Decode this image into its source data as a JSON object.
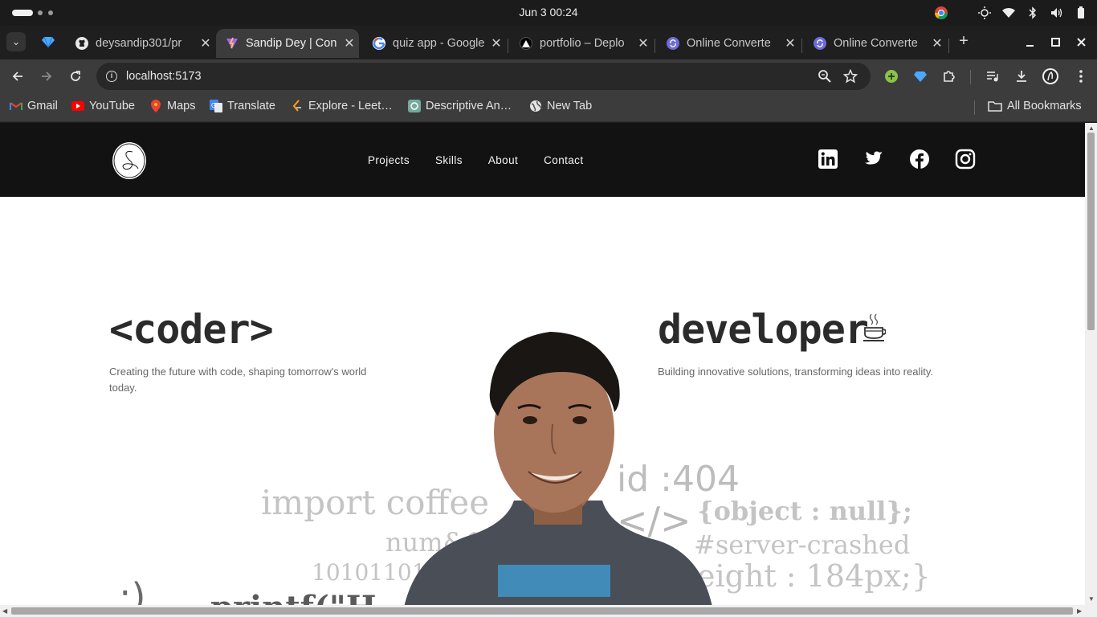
{
  "os": {
    "clock": "Jun 3  00:24"
  },
  "tabs": [
    {
      "title": "deysandip301/pr",
      "icon": "github-icon",
      "active": false
    },
    {
      "title": "Sandip Dey | Con",
      "icon": "vite-icon",
      "active": true
    },
    {
      "title": "quiz app - Google",
      "icon": "google-icon",
      "active": false
    },
    {
      "title": "portfolio – Deplo",
      "icon": "vercel-icon",
      "active": false
    },
    {
      "title": "Online Converte",
      "icon": "converter-icon",
      "active": false
    },
    {
      "title": "Online Converte",
      "icon": "converter-icon",
      "active": false
    }
  ],
  "toolbar": {
    "url": "localhost:5173"
  },
  "bookmarks": {
    "items": [
      {
        "label": "Gmail",
        "icon": "gmail-icon"
      },
      {
        "label": "YouTube",
        "icon": "youtube-icon"
      },
      {
        "label": "Maps",
        "icon": "maps-icon"
      },
      {
        "label": "Translate",
        "icon": "translate-icon"
      },
      {
        "label": "Explore - Leet…",
        "icon": "leetcode-icon"
      },
      {
        "label": "Descriptive An…",
        "icon": "openai-icon"
      },
      {
        "label": "New Tab",
        "icon": "globe-icon"
      }
    ],
    "all_bookmarks": "All Bookmarks"
  },
  "site": {
    "nav": {
      "links": [
        "Projects",
        "Skills",
        "About",
        "Contact"
      ]
    },
    "socials": [
      "linkedin-icon",
      "twitter-icon",
      "facebook-icon",
      "instagram-icon"
    ],
    "hero": {
      "left_title": "<coder>",
      "left_subtitle": "Creating the future with code, shaping tomorrow's world today.",
      "right_title": "developer",
      "right_subtitle": "Building innovative solutions, transforming ideas into reality."
    },
    "background_code": {
      "import_coffee": "import coffee",
      "num": "num&1",
      "binary": "10101101010",
      "printf": "printf(\"H",
      "id": "id :404",
      "closing_tag": "</>",
      "object_null": "{object : null};",
      "server_crashed": "#server-crashed",
      "height": "eight : 184px;}",
      "paren": ":)"
    }
  },
  "colors": {
    "site_nav_bg": "#121212",
    "hero_title": "#2b2b2b",
    "hero_sub": "#666666",
    "bg_code_text": "#c4c4c4"
  }
}
